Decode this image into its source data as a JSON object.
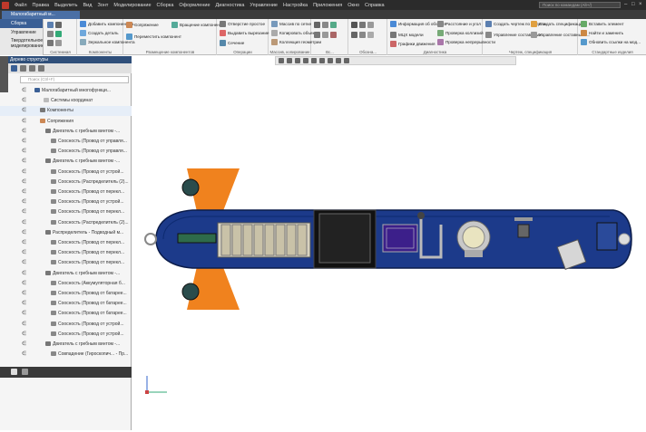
{
  "menu": {
    "items": [
      "Файл",
      "Правка",
      "Выделить",
      "Вид",
      "Зонт",
      "Моделирование",
      "Сборка",
      "Оформление",
      "Диагностика",
      "Управление",
      "Настройка",
      "Приложения",
      "Окно",
      "Справка"
    ],
    "search_placeholder": "Поиск по командам (Alt+/)"
  },
  "document_tab": "Малогабаритный м...",
  "ribbon": {
    "side": [
      "Сборка",
      "Управление",
      "Твердотельное моделирование"
    ],
    "buttons": {
      "add_component": "Добавить компонент из...",
      "create_part": "Создать деталь",
      "mirror_component": "Зеркальное компонента",
      "combine": "Сопряжение",
      "rotate_component": "Вращение компонента",
      "move_component": "Переместить компонент",
      "opening": "Отверстие простое",
      "extrude_cut": "Выдавить вырезание",
      "section": "Сечение",
      "array_pattern": "Массив по сетке",
      "copy_objects": "Копировать объекты",
      "collection": "Коллекция геометрии",
      "object_info": "Информация об объекте",
      "mcx_model": "МЦХ модели",
      "display_graphs": "Графики движения",
      "distance_angle": "Расстояние и угол",
      "check_collisions": "Проверка коллизий",
      "check_continuity": "Проверка непрерывности",
      "create_drawing": "Создать чертеж по модели",
      "manage_spec": "Управление составными...",
      "create_spec": "Создать спецификацию",
      "manage_spec2": "Управление составными...",
      "insert_element": "Вставить элемент",
      "find_replace": "Найти и заменить",
      "update_links": "Обновить ссылки на мод..."
    },
    "groups": [
      "Системная",
      "Компоненты",
      "Размещение компонентов",
      "Операции",
      "Массив, копирование",
      "Вс...",
      "Обозна...",
      "Диагностика",
      "Чертеж, спецификация",
      "Стандартные изделия"
    ]
  },
  "panel": {
    "title": "Дерево структуры",
    "search_placeholder": "Поиск (Ctrl+F)",
    "rows": [
      "Малогабаритный многофункци...",
      "Системы координат",
      "Компоненты",
      "Сопряжения",
      "Двигатель с гребным винтом -...",
      "Соосность (Провод от управля...",
      "Соосность (Провод от управля...",
      "Двигатель с гребным винтом -...",
      "Соосность (Провод от устрой...",
      "Соосность (Распределитель (2)...",
      "Соосность (Провод от перекл...",
      "Соосность (Провод от устрой...",
      "Соосность (Провод от перекл...",
      "Соосность (Распределитель (2)...",
      "Распределитель - Подводный м...",
      "Соосность (Провод от перекл...",
      "Соосность (Провод от перекл...",
      "Соосность (Провод от перекл...",
      "Двигатель с гребным винтом -...",
      "Соосность (Аккумуляторная б...",
      "Соосность (Провод от батарее...",
      "Соосность (Провод от батарее...",
      "Соосность (Провод от батарее...",
      "Соосность (Провод от устрой...",
      "Соосность (Провод от устрой...",
      "Двигатель с гребным винтом -...",
      "Совпадение (Гироскопич... - Пр..."
    ]
  },
  "colors": {
    "hull": "#1c3a8a",
    "fins": "#f0821e",
    "ribbon_bg": "#f3f3f3",
    "menubar": "#2b2b2b",
    "panel_title": "#2f4f7a"
  }
}
